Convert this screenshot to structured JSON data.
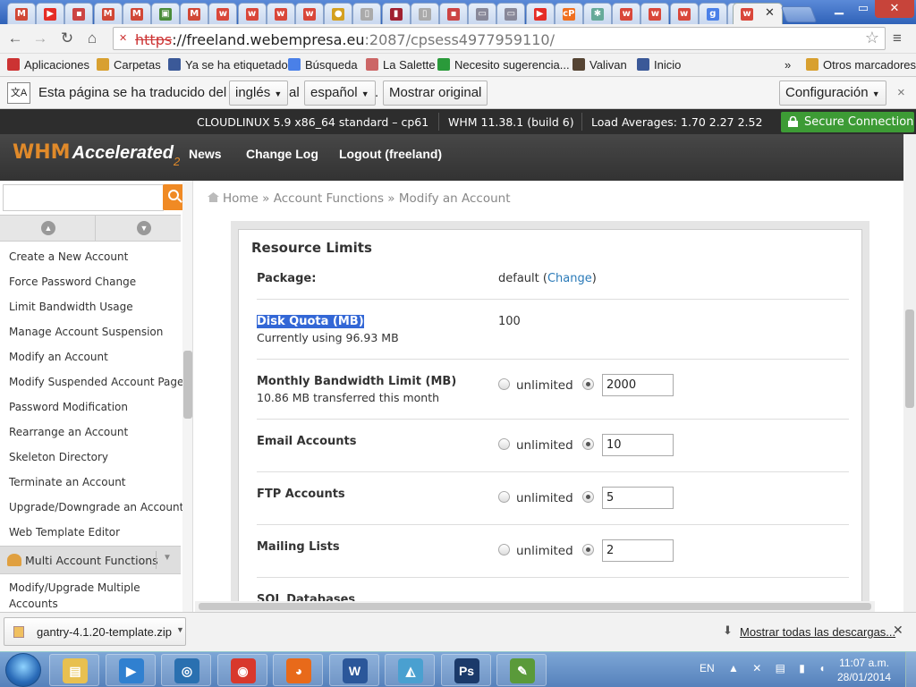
{
  "browser": {
    "tabs": [
      {
        "icon": "gmail-icon",
        "color": "#d14836",
        "glyph": "M"
      },
      {
        "icon": "youtube-icon",
        "color": "#e52d27",
        "glyph": "▶"
      },
      {
        "icon": "bookmark-icon",
        "color": "#c44",
        "glyph": "▪"
      },
      {
        "icon": "gmail-icon",
        "color": "#d14836",
        "glyph": "M"
      },
      {
        "icon": "gmail-icon",
        "color": "#d14836",
        "glyph": "M"
      },
      {
        "icon": "site-icon",
        "color": "#4a8c3a",
        "glyph": "▣"
      },
      {
        "icon": "gmail-icon",
        "color": "#d14836",
        "glyph": "M"
      },
      {
        "icon": "wix-icon",
        "color": "#d9473a",
        "glyph": "w"
      },
      {
        "icon": "wix-icon",
        "color": "#d9473a",
        "glyph": "w"
      },
      {
        "icon": "wix-icon",
        "color": "#d9473a",
        "glyph": "w"
      },
      {
        "icon": "wix-icon",
        "color": "#d9473a",
        "glyph": "w"
      },
      {
        "icon": "coin-icon",
        "color": "#d4a020",
        "glyph": "●"
      },
      {
        "icon": "document-icon",
        "color": "#aaa",
        "glyph": "▯"
      },
      {
        "icon": "book-icon",
        "color": "#a02030",
        "glyph": "▮"
      },
      {
        "icon": "document-icon",
        "color": "#aaa",
        "glyph": "▯"
      },
      {
        "icon": "bookmark-icon",
        "color": "#c44",
        "glyph": "▪"
      },
      {
        "icon": "folder-icon",
        "color": "#889",
        "glyph": "▭"
      },
      {
        "icon": "folder-icon",
        "color": "#889",
        "glyph": "▭"
      },
      {
        "icon": "youtube-icon",
        "color": "#e52d27",
        "glyph": "▶"
      },
      {
        "icon": "cpanel-icon",
        "color": "#f07020",
        "glyph": "cP"
      },
      {
        "icon": "joomla-icon",
        "color": "#6a9",
        "glyph": "✱"
      },
      {
        "icon": "wix-icon",
        "color": "#d9473a",
        "glyph": "w"
      },
      {
        "icon": "wix-icon",
        "color": "#d9473a",
        "glyph": "w"
      },
      {
        "icon": "wix-icon",
        "color": "#d9473a",
        "glyph": "w"
      },
      {
        "icon": "google-icon",
        "color": "#4a80e8",
        "glyph": "g"
      },
      {
        "icon": "building-icon",
        "color": "#a33",
        "glyph": "▥"
      },
      {
        "icon": "wix-icon",
        "color": "#d9473a",
        "glyph": "w"
      }
    ],
    "url_scheme": "https",
    "url_host": "://freeland.webempresa.eu",
    "url_rest": ":2087/cpsess4977959110/"
  },
  "bookmarks": [
    {
      "label": "Aplicaciones",
      "icon": "apps-icon",
      "color": "#c33"
    },
    {
      "label": "Carpetas",
      "icon": "folder-icon",
      "color": "#d8a030"
    },
    {
      "label": "Ya se ha etiquetado",
      "icon": "facebook-icon",
      "color": "#3b5998"
    },
    {
      "label": "Búsqueda",
      "icon": "google-icon",
      "color": "#4a80e8"
    },
    {
      "label": "La Salette",
      "icon": "leaf-icon",
      "color": "#c66"
    },
    {
      "label": "Necesito sugerencia...",
      "icon": "star-icon",
      "color": "#2a9a3a"
    },
    {
      "label": "Valivan",
      "icon": "person-icon",
      "color": "#543"
    },
    {
      "label": "Inicio",
      "icon": "facebook-icon",
      "color": "#3b5998"
    }
  ],
  "bookmarks_more": "»",
  "bookmarks_other": "Otros marcadores",
  "translate": {
    "text1": "Esta página se ha traducido del",
    "from": "inglés",
    "al": "al",
    "to": "español",
    "dot": ".",
    "show_original": "Mostrar original",
    "config": "Configuración",
    "close": "×"
  },
  "status": {
    "os": "CLOUDLINUX 5.9 x86_64 standard – cp61",
    "whm": "WHM 11.38.1 (build 6)",
    "load": "Load Averages: 1.70 2.27 2.52",
    "secure": "Secure Connection"
  },
  "header": {
    "logo_whm": "WHM",
    "logo_acc": "Accelerated",
    "logo_two": "2",
    "nav": [
      "News",
      "Change Log",
      "Logout (freeland)"
    ]
  },
  "sidebar": {
    "items": [
      "Create a New Account",
      "Force Password Change",
      "Limit Bandwidth Usage",
      "Manage Account Suspension",
      "Modify an Account",
      "Modify Suspended Account Page",
      "Password Modification",
      "Rearrange an Account",
      "Skeleton Directory",
      "Terminate an Account",
      "Upgrade/Downgrade an Account",
      "Web Template Editor"
    ],
    "multi_header": "Multi Account Functions",
    "multi_items": [
      "Modify/Upgrade Multiple",
      "Accounts"
    ]
  },
  "breadcrumb": {
    "home": "Home",
    "sep": "»",
    "section": "Account Functions",
    "page": "Modify an Account"
  },
  "panel": {
    "title": "Resource Limits",
    "package_label": "Package:",
    "package_value": "default",
    "package_change": "Change",
    "disk_label": "Disk Quota (MB)",
    "disk_sub": "Currently using 96.93 MB",
    "disk_value": "100",
    "unlimited": "unlimited",
    "rows": [
      {
        "label": "Monthly Bandwidth Limit (MB)",
        "sub": "10.86 MB transferred this month",
        "value": "2000"
      },
      {
        "label": "Email Accounts",
        "sub": "",
        "value": "10"
      },
      {
        "label": "FTP Accounts",
        "sub": "",
        "value": "5"
      },
      {
        "label": "Mailing Lists",
        "sub": "",
        "value": "2"
      }
    ],
    "partial_label": "SQL Databases"
  },
  "downloads": {
    "file": "gantry-4.1.20-template.zip",
    "show_all": "Mostrar todas las descargas..."
  },
  "taskbar": {
    "apps": [
      {
        "icon": "explorer-icon",
        "color": "#e8c050",
        "glyph": "▤"
      },
      {
        "icon": "media-player-icon",
        "color": "#3080d0",
        "glyph": "▶"
      },
      {
        "icon": "network-icon",
        "color": "#2a70b0",
        "glyph": "◎"
      },
      {
        "icon": "chrome-icon",
        "color": "#d8382c",
        "glyph": "◉"
      },
      {
        "icon": "firefox-icon",
        "color": "#e86a1a",
        "glyph": "◕"
      },
      {
        "icon": "word-icon",
        "color": "#2b579a",
        "glyph": "W"
      },
      {
        "icon": "sail-icon",
        "color": "#4aa0d0",
        "glyph": "◭"
      },
      {
        "icon": "photoshop-icon",
        "color": "#1b3a6a",
        "glyph": "Ps"
      },
      {
        "icon": "dreamweaver-icon",
        "color": "#5a9a3a",
        "glyph": "✎"
      }
    ],
    "lang": "EN",
    "tray": "▲ ✕ ▤ ▮ ◖",
    "time": "11:07 a.m.",
    "date": "28/01/2014"
  }
}
